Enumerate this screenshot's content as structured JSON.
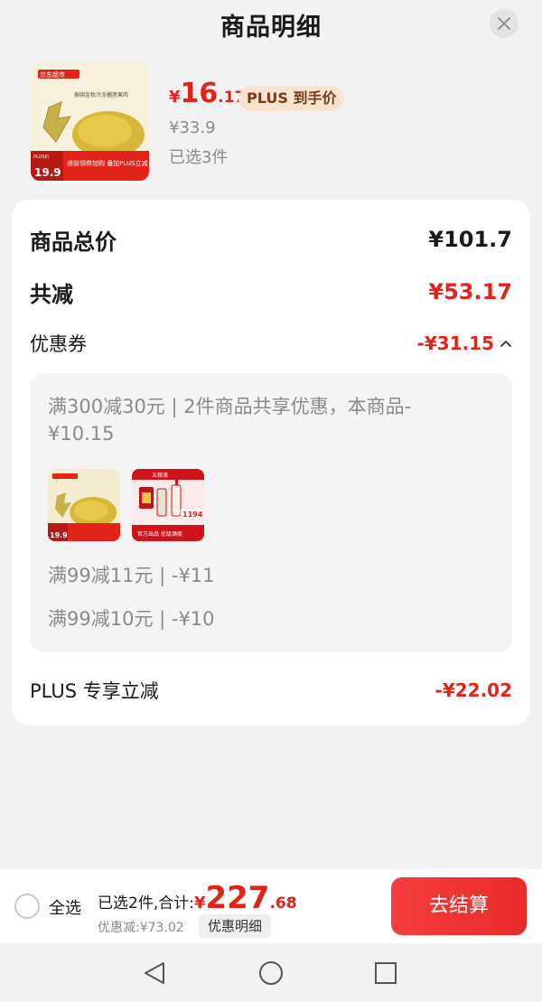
{
  "header": {
    "title": "商品明细",
    "close_icon": "close-icon"
  },
  "product": {
    "price_symbol": "¥",
    "price_integer": "16",
    "price_decimal": ".17",
    "plus_badge": "PLUS 到手价",
    "original_price": "¥33.9",
    "selected_count": "已选3件",
    "thumbnail_text": {
      "store": "京东超市",
      "name": "泰国金枕冷冻榴莲果肉",
      "promo": "搭前领券加购 叠加PLUS立减",
      "small_price": "19.9",
      "tag": "PLUS价"
    }
  },
  "detail": {
    "total_label": "商品总价",
    "total_value": "¥101.7",
    "reduce_label": "共减",
    "reduce_value": "¥53.17",
    "coupon_label": "优惠券",
    "coupon_value": "-¥31.15",
    "coupon_rule": "满300减30元 | 2件商品共享优惠，本商品-¥10.15",
    "coupon_lines": [
      "满99减11元 | -¥11",
      "满99减10元 | -¥10"
    ],
    "thumb2_text": {
      "brand": "五粮液",
      "price": "1194",
      "slogan": "官方出品  优级酒类"
    },
    "plus_label": "PLUS 专享立减",
    "plus_value": "-¥22.02"
  },
  "bottom": {
    "select_all": "全选",
    "sum_label": "已选2件,合计:",
    "sum_symbol": "¥",
    "sum_integer": "227",
    "sum_decimal": ".68",
    "discount_text": "优惠减:¥73.02",
    "detail_tag": "优惠明细",
    "checkout": "去结算"
  },
  "navbar": {
    "icons": [
      "back-icon",
      "home-icon",
      "recent-apps-icon"
    ]
  },
  "colors": {
    "accent_red": "#e2231a",
    "button_red": "#f63d3d",
    "plus_badge_bg": "#fbe3d2",
    "page_bg": "#f2f2f2"
  }
}
